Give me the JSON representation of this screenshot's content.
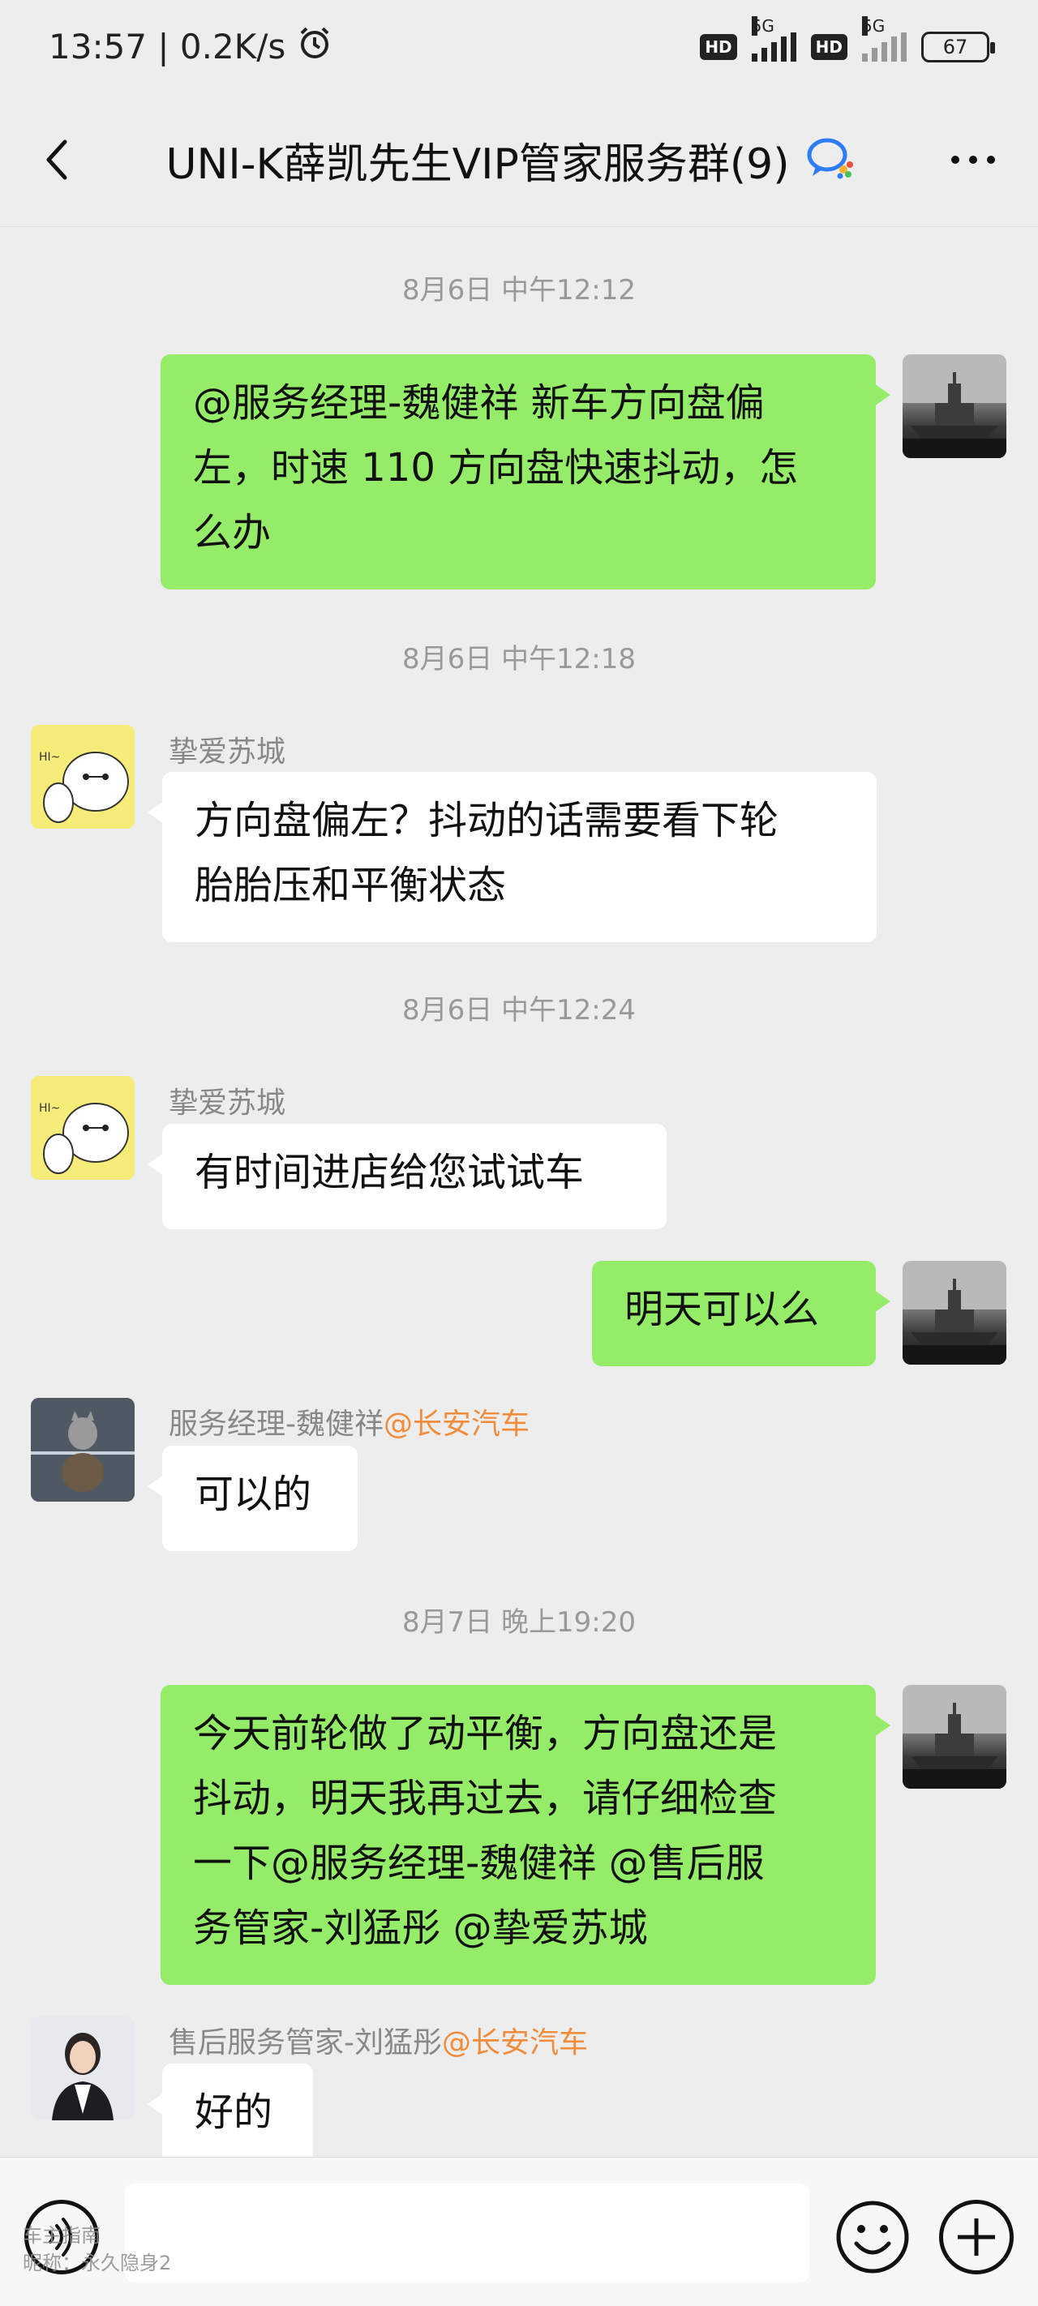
{
  "status_bar": {
    "time_speed": "13:57 | 0.2K/s",
    "network_1": "5G",
    "network_2": "5G",
    "hd_label": "HD",
    "battery": "67"
  },
  "nav": {
    "title": "UNI-K薛凯先生VIP管家服务群(9)"
  },
  "messages": [
    {
      "type": "timestamp",
      "text": "8月6日 中午12:12"
    },
    {
      "type": "outgoing",
      "lines": [
        "@服务经理-魏健祥  新车方向盘偏",
        "左，时速 110 方向盘快速抖动，怎",
        "么办"
      ]
    },
    {
      "type": "timestamp",
      "text": "8月6日 中午12:18"
    },
    {
      "type": "incoming",
      "sender": "挚爱苏城",
      "lines": [
        "方向盘偏左？抖动的话需要看下轮",
        "胎胎压和平衡状态"
      ]
    },
    {
      "type": "timestamp",
      "text": "8月6日 中午12:24"
    },
    {
      "type": "incoming",
      "sender": "挚爱苏城",
      "lines": [
        "有时间进店给您试试车"
      ]
    },
    {
      "type": "outgoing",
      "lines": [
        "明天可以么"
      ]
    },
    {
      "type": "incoming",
      "sender": "服务经理-魏健祥",
      "sender_org": "@长安汽车",
      "lines": [
        "可以的"
      ]
    },
    {
      "type": "timestamp",
      "text": "8月7日 晚上19:20"
    },
    {
      "type": "outgoing",
      "lines": [
        "今天前轮做了动平衡，方向盘还是",
        "抖动，明天我再过去，请仔细检查",
        "一下@服务经理-魏健祥  @售后服",
        "务管家-刘猛彤  @挚爱苏城"
      ]
    },
    {
      "type": "incoming",
      "sender": "售后服务管家-刘猛彤",
      "sender_org": "@长安汽车",
      "lines": [
        "好的"
      ]
    }
  ],
  "input_bar": {
    "placeholder": "",
    "voice_icon": "voice-icon",
    "emoji_icon": "emoji-icon",
    "plus_icon": "plus-icon"
  },
  "watermark": {
    "line1": "车主指南",
    "line2": "昵称：永久隐身2"
  },
  "colors": {
    "outgoing_bubble": "#95ec69",
    "incoming_bubble": "#ffffff",
    "background": "#ededed",
    "org_tag": "#f08c3a"
  }
}
